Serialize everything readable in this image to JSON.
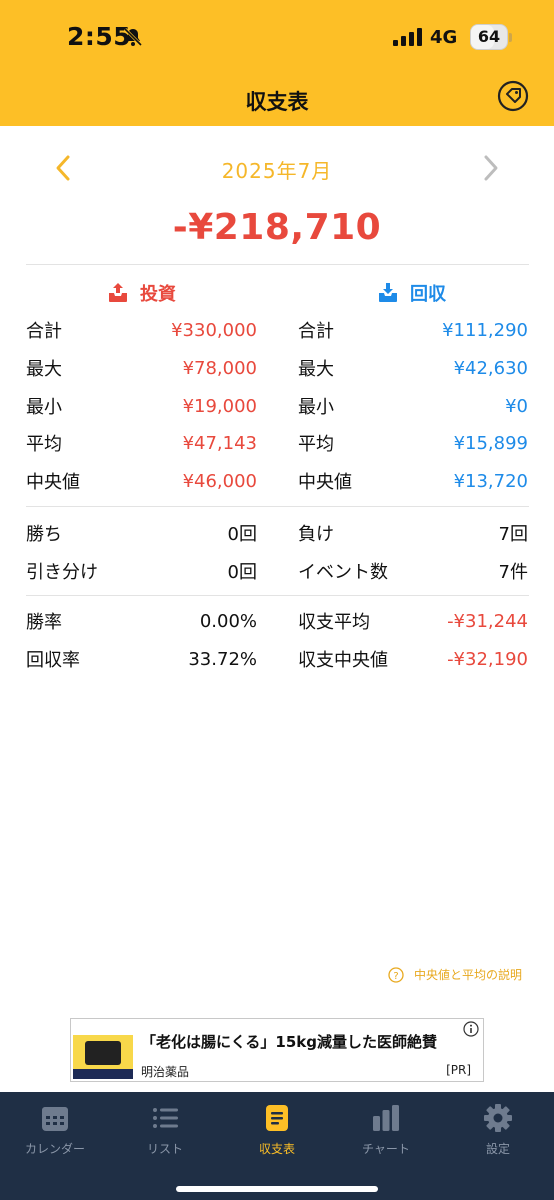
{
  "status_bar": {
    "time": "2:55",
    "network": "4G",
    "battery_level": "64",
    "battery_fraction": 0.64
  },
  "header": {
    "title": "収支表",
    "tag_icon": "price-tag-icon"
  },
  "month_nav": {
    "label": "2025年7月",
    "prev_icon": "chevron-left-icon",
    "next_icon": "chevron-right-icon"
  },
  "balance": "-¥218,710",
  "invest": {
    "title": "投資",
    "rows": [
      {
        "label": "合計",
        "value": "¥330,000"
      },
      {
        "label": "最大",
        "value": "¥78,000"
      },
      {
        "label": "最小",
        "value": "¥19,000"
      },
      {
        "label": "平均",
        "value": "¥47,143"
      },
      {
        "label": "中央値",
        "value": "¥46,000"
      }
    ]
  },
  "recovery": {
    "title": "回収",
    "rows": [
      {
        "label": "合計",
        "value": "¥111,290"
      },
      {
        "label": "最大",
        "value": "¥42,630"
      },
      {
        "label": "最小",
        "value": "¥0"
      },
      {
        "label": "平均",
        "value": "¥15,899"
      },
      {
        "label": "中央値",
        "value": "¥13,720"
      }
    ]
  },
  "results": {
    "left": [
      {
        "label": "勝ち",
        "value": "0回"
      },
      {
        "label": "引き分け",
        "value": "0回"
      }
    ],
    "right": [
      {
        "label": "負け",
        "value": "7回"
      },
      {
        "label": "イベント数",
        "value": "7件"
      }
    ]
  },
  "rates": {
    "left": [
      {
        "label": "勝率",
        "value": "0.00%"
      },
      {
        "label": "回収率",
        "value": "33.72%"
      }
    ],
    "right": [
      {
        "label": "収支平均",
        "value": "-¥31,244"
      },
      {
        "label": "収支中央値",
        "value": "-¥32,190"
      }
    ]
  },
  "explain_link": "中央値と平均の説明",
  "ad": {
    "headline": "「老化は腸にくる」15kg減量した医師絶賛",
    "sponsor": "明治薬品",
    "pr_label": "[PR]"
  },
  "tabs": [
    {
      "label": "カレンダー",
      "icon": "calendar-icon",
      "active": false
    },
    {
      "label": "リスト",
      "icon": "list-icon",
      "active": false
    },
    {
      "label": "収支表",
      "icon": "document-icon",
      "active": true
    },
    {
      "label": "チャート",
      "icon": "bar-chart-icon",
      "active": false
    },
    {
      "label": "設定",
      "icon": "gear-icon",
      "active": false
    }
  ],
  "colors": {
    "brand_yellow": "#FDBF26",
    "loss_red": "#E8493D",
    "gain_blue": "#1E8BE8",
    "tabbar_bg": "#1F2F45"
  }
}
